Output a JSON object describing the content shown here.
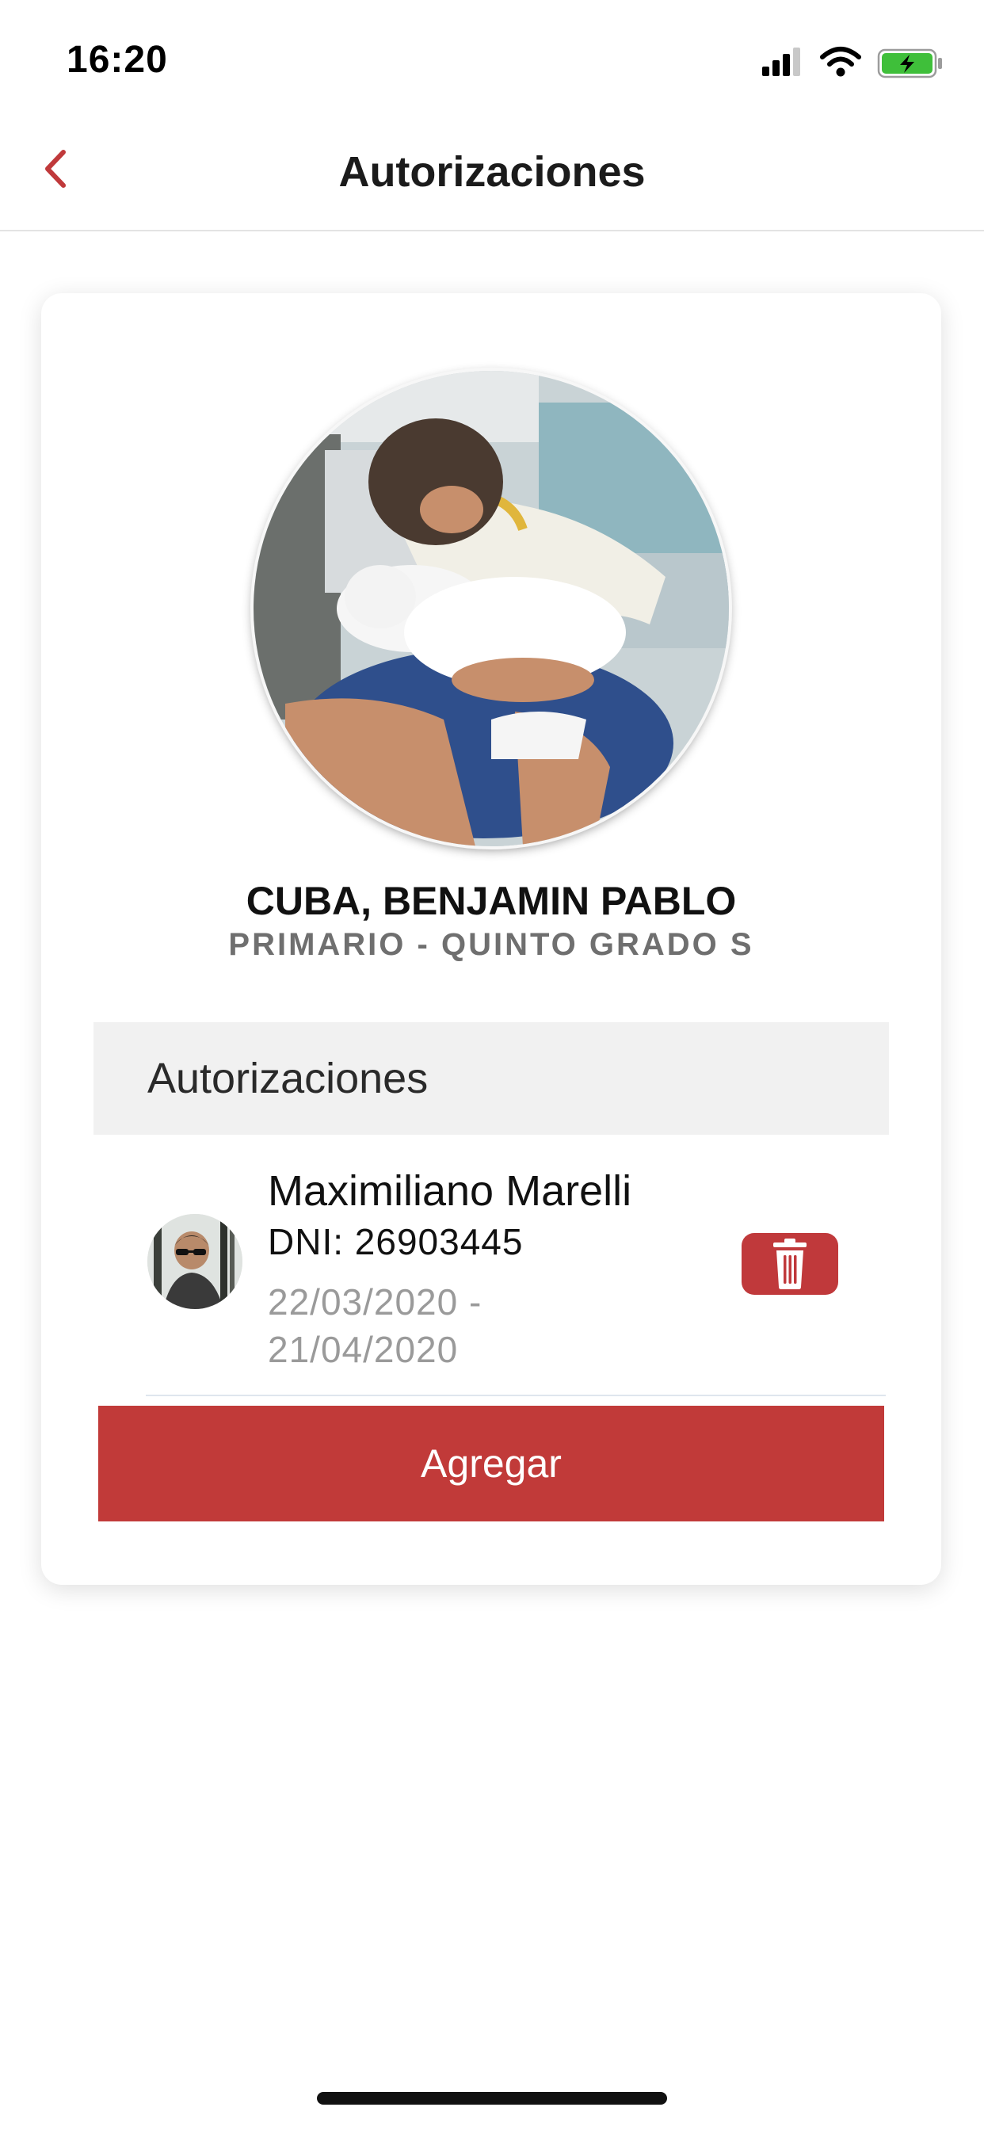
{
  "status_bar": {
    "time": "16:20",
    "icons": [
      "signal-icon",
      "wifi-icon",
      "battery-charging-icon"
    ],
    "battery_color": "#3fbf3a"
  },
  "nav": {
    "title": "Autorizaciones",
    "back_icon": "chevron-left-icon"
  },
  "student": {
    "name": "CUBA, BENJAMIN PABLO",
    "grade": "PRIMARIO - QUINTO GRADO S"
  },
  "authorizations": {
    "section_title": "Autorizaciones",
    "items": [
      {
        "name": "Maximiliano Marelli",
        "dni": "DNI: 26903445",
        "date_from": "22/03/2020 -",
        "date_to": "21/04/2020",
        "delete_icon": "trash-icon"
      }
    ],
    "add_label": "Agregar"
  },
  "colors": {
    "accent": "#c0393b",
    "nav_back": "#c0393b",
    "secondary_text": "#9a9a9a"
  }
}
